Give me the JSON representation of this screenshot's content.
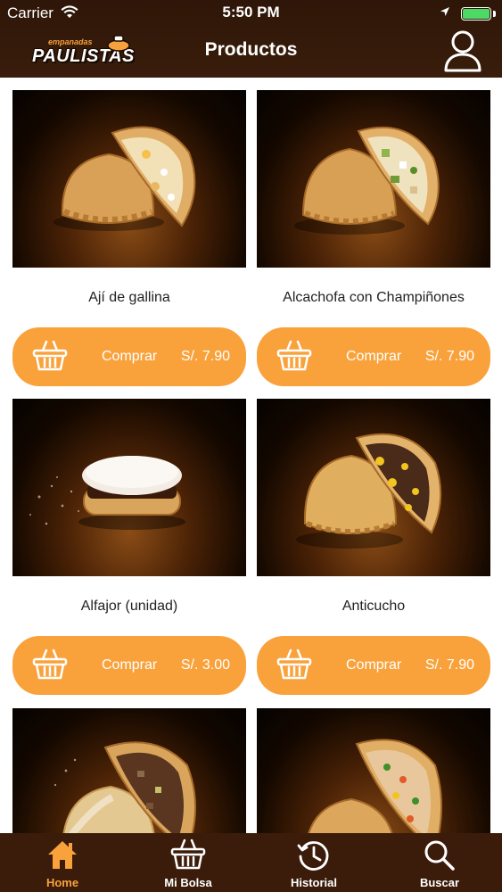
{
  "status_bar": {
    "carrier": "Carrier",
    "time": "5:50 PM"
  },
  "header": {
    "logo_small": "empanadas",
    "logo_big": "PAULISTAS",
    "title": "Productos"
  },
  "products": [
    {
      "name": "Ají de gallina",
      "buy_label": "Comprar",
      "price": "S/. 7.90",
      "filling": "chicken"
    },
    {
      "name": "Alcachofa con Champiñones",
      "buy_label": "Comprar",
      "price": "S/. 7.90",
      "filling": "artichoke"
    },
    {
      "name": "Alfajor (unidad)",
      "buy_label": "Comprar",
      "price": "S/. 3.00",
      "filling": "alfajor"
    },
    {
      "name": "Anticucho",
      "buy_label": "Comprar",
      "price": "S/. 7.90",
      "filling": "anticucho"
    },
    {
      "name": "",
      "buy_label": "",
      "price": "",
      "filling": "beef"
    },
    {
      "name": "",
      "buy_label": "",
      "price": "",
      "filling": "mixed"
    }
  ],
  "tabbar": {
    "tabs": [
      {
        "label": "Home",
        "icon": "home-icon",
        "active": true
      },
      {
        "label": "Mi Bolsa",
        "icon": "basket-icon",
        "active": false
      },
      {
        "label": "Historial",
        "icon": "clock-icon",
        "active": false
      },
      {
        "label": "Buscar",
        "icon": "search-icon",
        "active": false
      }
    ]
  },
  "colors": {
    "brand_brown": "#3b1c0a",
    "accent_orange": "#f9a23c",
    "text_dark": "#222222"
  }
}
